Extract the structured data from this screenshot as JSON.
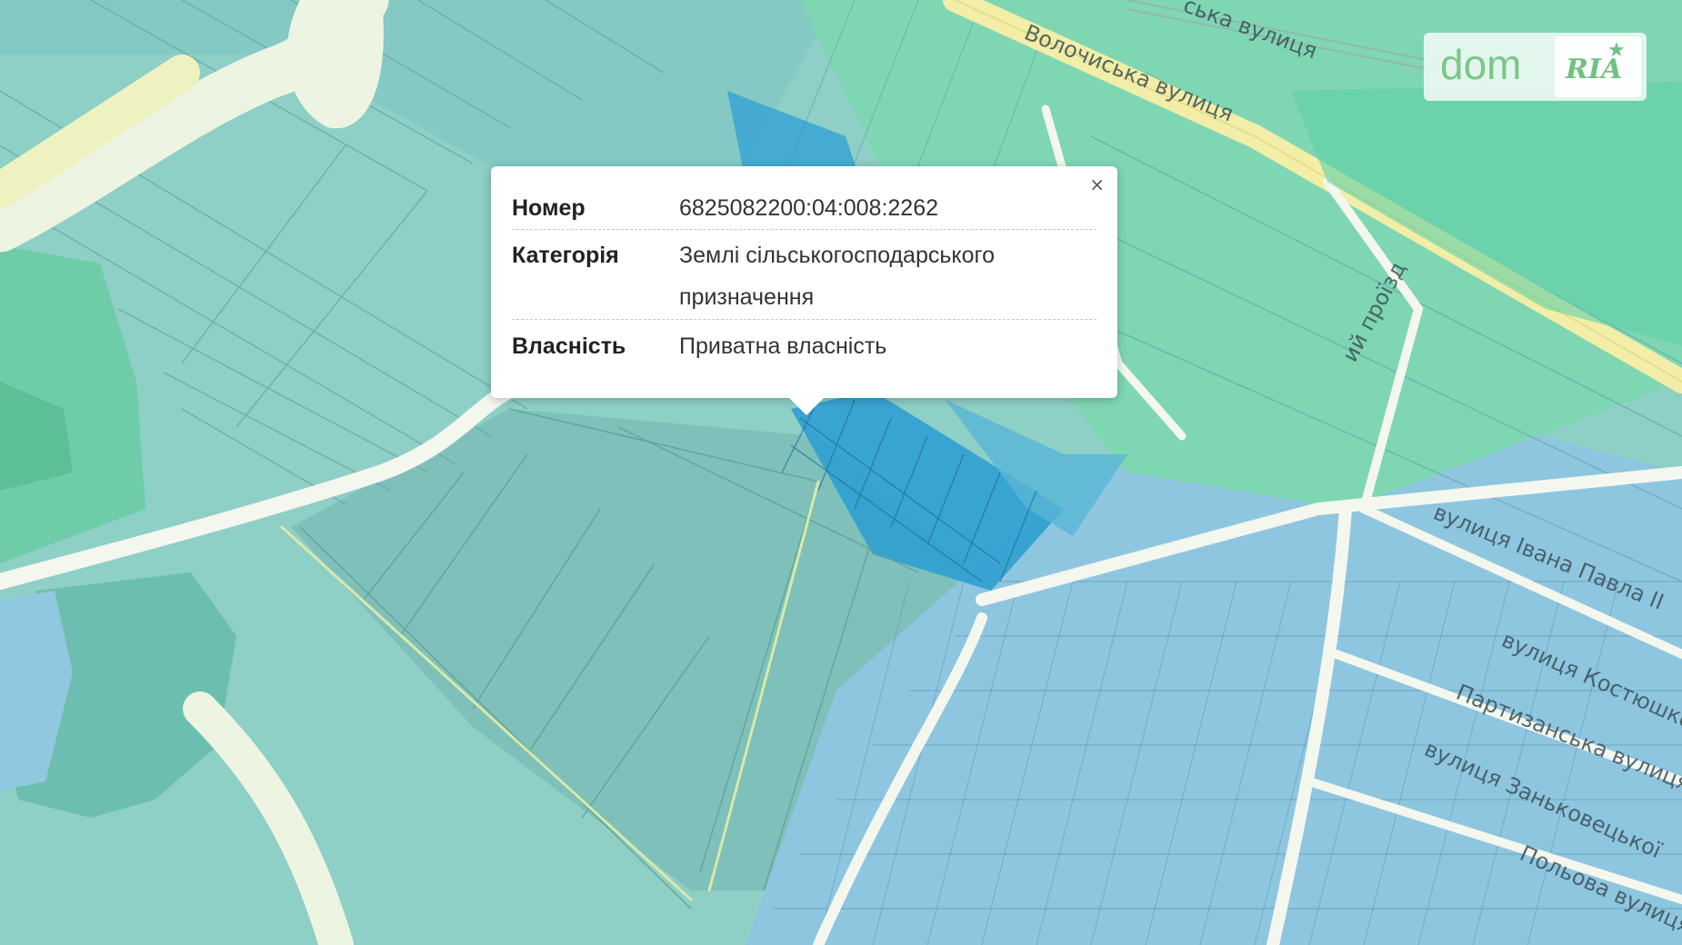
{
  "popup": {
    "rows": [
      {
        "label": "Номер",
        "value": "6825082200:04:008:2262"
      },
      {
        "label": "Категорія",
        "value_line1": "Землі сільськогосподарського",
        "value_line2": "призначення"
      },
      {
        "label": "Власність",
        "value": "Приватна власність"
      }
    ],
    "close_symbol": "×"
  },
  "streets": [
    {
      "text": "Волочиська вулиця"
    },
    {
      "text": "ська вулиця"
    },
    {
      "text": "ий проїзд"
    },
    {
      "text": "вулиця Івана Павла ІІ"
    },
    {
      "text": "вулиця Костюшко"
    },
    {
      "text": "Партизанська вулиця"
    },
    {
      "text": "вулиця Заньковецької"
    },
    {
      "text": "Польова вулиця"
    }
  ],
  "logo": {
    "dom": "dom",
    "ria": "RIA"
  },
  "colors": {
    "field": "#8ecfc6",
    "parcel_blue": "#7ec3dc",
    "parcel_green": "#5fcfa5",
    "selected": "#2f9fd2",
    "road": "#f4f7ee",
    "main_road": "#f2eea7"
  },
  "icons": {
    "close": "close-icon",
    "logo_star": "star-icon"
  }
}
